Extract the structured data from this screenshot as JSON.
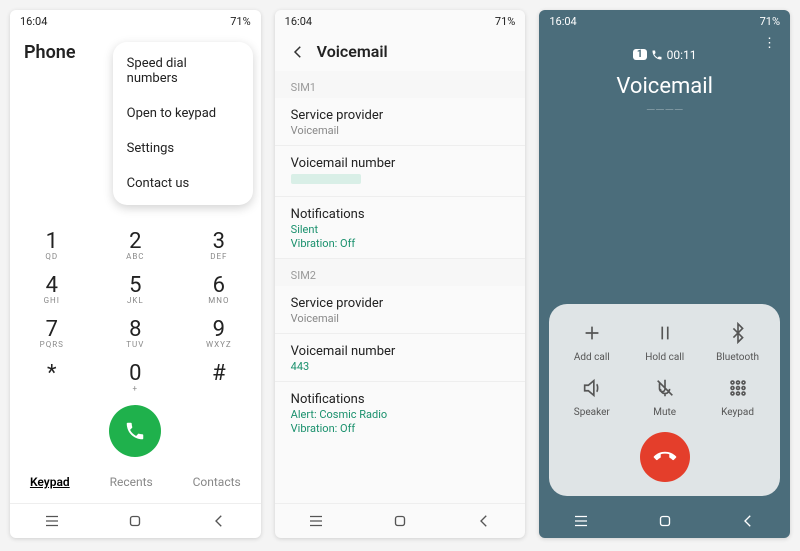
{
  "status": {
    "time": "16:04",
    "battery": "71%",
    "icons": "☼ ⌂ ⋯"
  },
  "screen1": {
    "title": "Phone",
    "menu": [
      "Speed dial numbers",
      "Open to keypad",
      "Settings",
      "Contact us"
    ],
    "keys": [
      {
        "d": "1",
        "l": "QD"
      },
      {
        "d": "2",
        "l": "ABC"
      },
      {
        "d": "3",
        "l": "DEF"
      },
      {
        "d": "4",
        "l": "GHI"
      },
      {
        "d": "5",
        "l": "JKL"
      },
      {
        "d": "6",
        "l": "MNO"
      },
      {
        "d": "7",
        "l": "PQRS"
      },
      {
        "d": "8",
        "l": "TUV"
      },
      {
        "d": "9",
        "l": "WXYZ"
      },
      {
        "d": "*",
        "l": ""
      },
      {
        "d": "0",
        "l": "+"
      },
      {
        "d": "#",
        "l": ""
      }
    ],
    "tabs": {
      "keypad": "Keypad",
      "recents": "Recents",
      "contacts": "Contacts"
    }
  },
  "screen2": {
    "title": "Voicemail",
    "sim1": {
      "head": "SIM1",
      "sp_t": "Service provider",
      "sp_s": "Voicemail",
      "vn_t": "Voicemail number",
      "nt_t": "Notifications",
      "nt_g1": "Silent",
      "nt_g2": "Vibration: Off"
    },
    "sim2": {
      "head": "SIM2",
      "sp_t": "Service provider",
      "sp_s": "Voicemail",
      "vn_t": "Voicemail number",
      "vn_g": "443",
      "nt_t": "Notifications",
      "nt_g1": "Alert: Cosmic Radio",
      "nt_g2": "Vibration: Off"
    }
  },
  "screen3": {
    "sim": "1",
    "timer": "00:11",
    "title": "Voicemail",
    "btns": {
      "add": "Add call",
      "hold": "Hold call",
      "bt": "Bluetooth",
      "spk": "Speaker",
      "mute": "Mute",
      "kp": "Keypad"
    }
  }
}
